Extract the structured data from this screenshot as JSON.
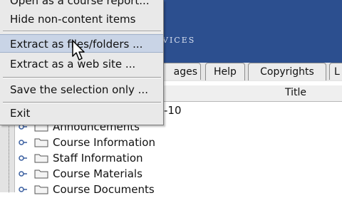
{
  "menu": {
    "items": [
      {
        "label": "Open as a course report..."
      },
      {
        "label": "Hide non-content items"
      },
      {
        "label": "Extract as files/folders ..."
      },
      {
        "label": "Extract as a web site ..."
      },
      {
        "label": "Save the selection only ..."
      },
      {
        "label": "Exit"
      }
    ]
  },
  "background": {
    "brand": "VICES",
    "tabs": [
      "ages",
      "Help",
      "Copyrights",
      "L"
    ],
    "column_header": "Title",
    "partial_value": "-10"
  },
  "tree": {
    "items": [
      {
        "label": "Announcements"
      },
      {
        "label": "Course Information"
      },
      {
        "label": "Staff Information"
      },
      {
        "label": "Course Materials"
      },
      {
        "label": "Course Documents"
      }
    ]
  },
  "colors": {
    "header_blue": "#2c4f8f",
    "menu_bg": "#e9e9e9",
    "highlight": "#c9d4e6",
    "folder_fill": "#f4f4f4",
    "handle_blue": "#3a5fa0"
  }
}
